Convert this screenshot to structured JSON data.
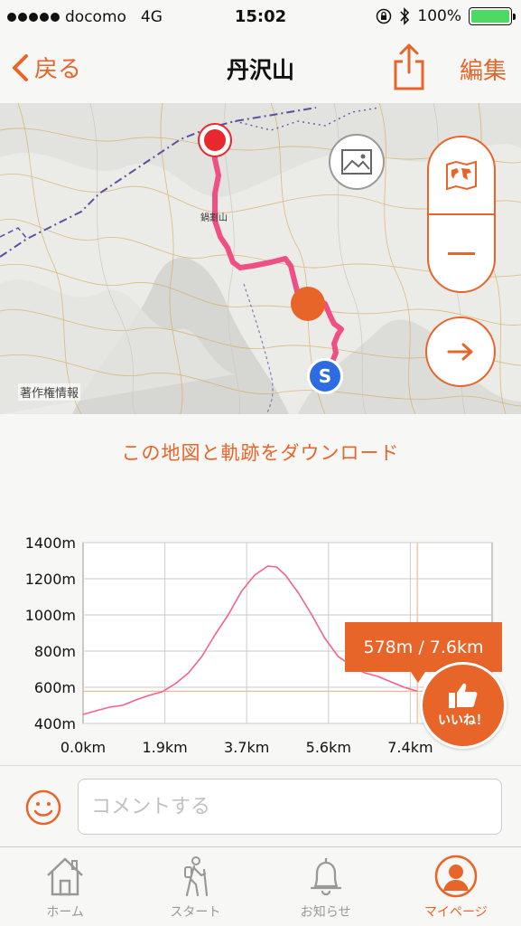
{
  "status": {
    "carrier": "docomo",
    "network": "4G",
    "time": "15:02",
    "battery": "100%"
  },
  "nav": {
    "back_label": "戻る",
    "title": "丹沢山",
    "edit_label": "編集"
  },
  "map": {
    "peak_label": "鍋割山",
    "credit": "著作権情報",
    "start_marker": "S"
  },
  "download_link": "この地図と軌跡をダウンロード",
  "chart_data": {
    "type": "area",
    "x": [
      0.0,
      0.3,
      0.6,
      0.9,
      1.2,
      1.5,
      1.8,
      2.1,
      2.4,
      2.7,
      3.0,
      3.3,
      3.6,
      3.9,
      4.2,
      4.4,
      4.6,
      4.9,
      5.2,
      5.5,
      5.8,
      6.1,
      6.4,
      6.7,
      7.0,
      7.3,
      7.6
    ],
    "y": [
      450,
      470,
      490,
      500,
      530,
      555,
      575,
      620,
      680,
      770,
      890,
      1000,
      1130,
      1220,
      1270,
      1265,
      1220,
      1120,
      1000,
      870,
      770,
      720,
      680,
      660,
      630,
      600,
      578
    ],
    "xticks": [
      "0.0km",
      "1.9km",
      "3.7km",
      "5.6km",
      "7.4km"
    ],
    "yticks": [
      "1400m",
      "1200m",
      "1000m",
      "800m",
      "600m",
      "400m"
    ],
    "ylim": [
      400,
      1400
    ],
    "xlim": [
      0,
      9.3
    ],
    "line_color": "#f06292",
    "grid": true
  },
  "tooltip": "578m / 7.6km",
  "like": {
    "label": "いいね！"
  },
  "comment": {
    "placeholder": "コメントする"
  },
  "tabs": [
    {
      "label": "ホーム",
      "icon": "home-icon"
    },
    {
      "label": "スタート",
      "icon": "hiker-icon"
    },
    {
      "label": "お知らせ",
      "icon": "bell-icon"
    },
    {
      "label": "マイページ",
      "icon": "user-icon"
    }
  ],
  "colors": {
    "accent": "#e8652a",
    "route": "#f06292",
    "start": "#2b6de0",
    "goal": "#e8282d"
  }
}
